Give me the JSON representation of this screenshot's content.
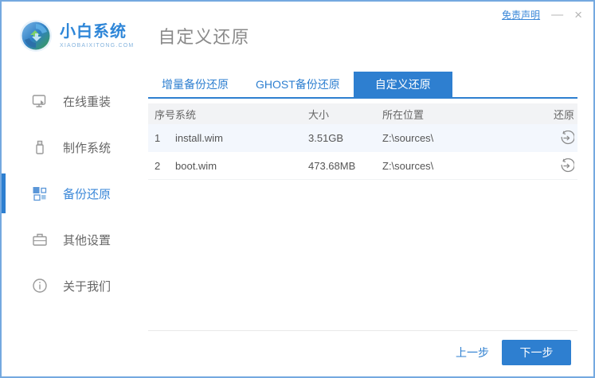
{
  "window": {
    "brand_name": "小白系统",
    "brand_domain": "XIAOBAIXITONG.COM",
    "page_title": "自定义还原",
    "disclaimer": "免责声明",
    "minimize_glyph": "—",
    "close_glyph": "×"
  },
  "sidebar": {
    "items": [
      {
        "label": "在线重装",
        "icon": "monitor-reinstall-icon",
        "active": false
      },
      {
        "label": "制作系统",
        "icon": "usb-drive-icon",
        "active": false
      },
      {
        "label": "备份还原",
        "icon": "backup-blocks-icon",
        "active": true
      },
      {
        "label": "其他设置",
        "icon": "toolbox-icon",
        "active": false
      },
      {
        "label": "关于我们",
        "icon": "info-circle-icon",
        "active": false
      }
    ]
  },
  "tabs": [
    {
      "label": "增量备份还原",
      "active": false
    },
    {
      "label": "GHOST备份还原",
      "active": false
    },
    {
      "label": "自定义还原",
      "active": true
    }
  ],
  "table": {
    "headers": {
      "index": "序号",
      "system": "系统",
      "size": "大小",
      "location": "所在位置",
      "restore": "还原"
    },
    "rows": [
      {
        "index": "1",
        "system": "install.wim",
        "size": "3.51GB",
        "location": "Z:\\sources\\"
      },
      {
        "index": "2",
        "system": "boot.wim",
        "size": "473.68MB",
        "location": "Z:\\sources\\"
      }
    ]
  },
  "footer": {
    "prev_label": "上一步",
    "next_label": "下一步"
  },
  "colors": {
    "accent": "#2e7fd0",
    "window_border": "#74a9e0",
    "row_alt_bg": "#f3f7fd",
    "header_row_bg": "#f2f3f5",
    "muted_text": "#8a8a8a"
  }
}
